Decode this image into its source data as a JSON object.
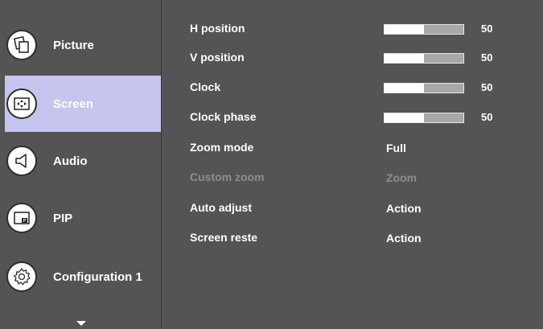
{
  "sidebar": {
    "items": [
      {
        "label": "Picture",
        "icon": "picture-icon",
        "active": false
      },
      {
        "label": "Screen",
        "icon": "screen-icon",
        "active": true
      },
      {
        "label": "Audio",
        "icon": "audio-icon",
        "active": false
      },
      {
        "label": "PIP",
        "icon": "pip-icon",
        "active": false
      },
      {
        "label": "Configuration 1",
        "icon": "configuration-icon",
        "active": false
      }
    ],
    "more_indicator": "chevron-down-icon"
  },
  "settings": {
    "h_position": {
      "label": "H position",
      "value": "50",
      "level": 0.5
    },
    "v_position": {
      "label": "V position",
      "value": "50",
      "level": 0.5
    },
    "clock": {
      "label": "Clock",
      "value": "50",
      "level": 0.5
    },
    "clock_phase": {
      "label": "Clock phase",
      "value": "50",
      "level": 0.5
    },
    "zoom_mode": {
      "label": "Zoom mode",
      "value": "Full"
    },
    "custom_zoom": {
      "label": "Custom zoom",
      "value": "Zoom",
      "disabled": true
    },
    "auto_adjust": {
      "label": "Auto adjust",
      "value": "Action"
    },
    "screen_reset": {
      "label": "Screen reste",
      "value": "Action"
    }
  },
  "colors": {
    "background": "#545454",
    "active_item": "#c5c5f0",
    "text": "#ffffff",
    "disabled_text": "#8e8e8e"
  }
}
